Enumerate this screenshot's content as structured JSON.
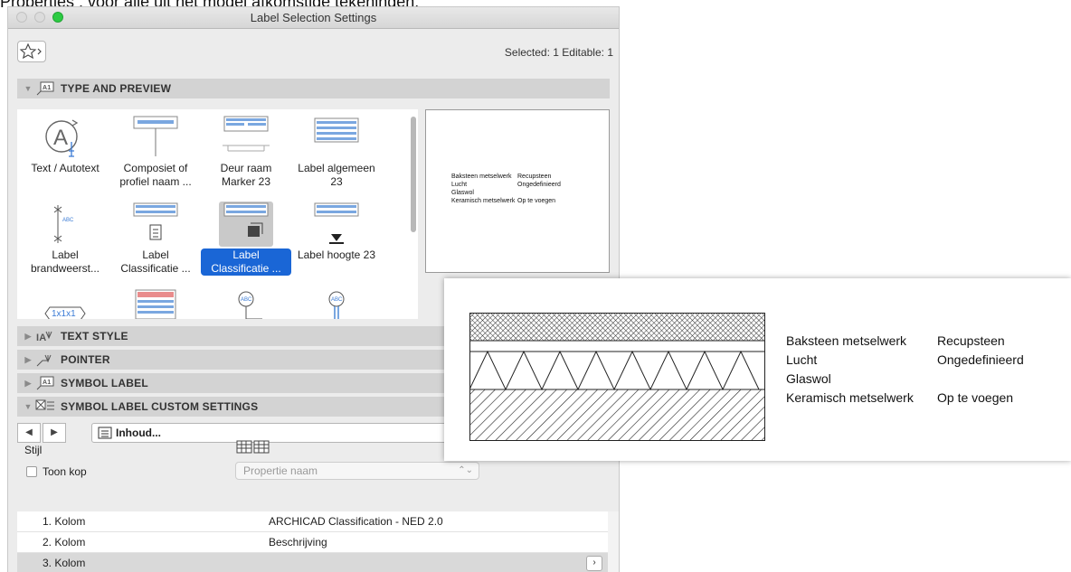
{
  "caption": "Properties , voor alle uit het model afkomstige tekeningen.",
  "window": {
    "title": "Label Selection Settings"
  },
  "header": {
    "selected_info": "Selected: 1 Editable: 1"
  },
  "sections": {
    "type_preview": "TYPE AND PREVIEW",
    "text_style": "TEXT STYLE",
    "pointer": "POINTER",
    "symbol_label": "SYMBOL LABEL",
    "custom_settings": "SYMBOL LABEL CUSTOM SETTINGS"
  },
  "gallery": [
    {
      "label": "Text / Autotext",
      "icon": "autotext-icon"
    },
    {
      "label": "Composiet of profiel naam ...",
      "icon": "composite-label-icon"
    },
    {
      "label": "Deur raam Marker 23",
      "icon": "door-window-marker-icon"
    },
    {
      "label": "Label algemeen 23",
      "icon": "general-label-icon"
    },
    {
      "label": "Label brandweerst...",
      "icon": "fire-resistance-label-icon"
    },
    {
      "label": "Label Classificatie ...",
      "icon": "classification-label-icon"
    },
    {
      "label": "Label Classificatie ...",
      "icon": "classification-label-3d-icon",
      "selected": true
    },
    {
      "label": "Label hoogte 23",
      "icon": "height-label-icon"
    },
    {
      "label": "",
      "icon": "dimension-label-icon",
      "text": "1x1x1"
    },
    {
      "label": "",
      "icon": "table-label-icon"
    },
    {
      "label": "",
      "icon": "circle-label-icon",
      "text": "ABC"
    },
    {
      "label": "",
      "icon": "circle-label-2-icon",
      "text": "ABC"
    }
  ],
  "preview": {
    "rows": [
      [
        "Baksteen metselwerk",
        "Recupsteen"
      ],
      [
        "Lucht",
        "Ongedefinieerd"
      ],
      [
        "Glaswol",
        ""
      ],
      [
        "Keramisch metselwerk",
        "Op te voegen"
      ]
    ]
  },
  "custom": {
    "content_button": "Inhoud...",
    "style_label": "Stijl",
    "toon_kop": "Toon kop",
    "property_placeholder": "Propertie naam",
    "columns": [
      {
        "name": "1. Kolom",
        "value": "ARCHICAD Classification - NED 2.0"
      },
      {
        "name": "2. Kolom",
        "value": "Beschrijving"
      },
      {
        "name": "3. Kolom",
        "value": ""
      }
    ]
  },
  "zoom": {
    "rows": [
      [
        "Baksteen metselwerk",
        "Recupsteen"
      ],
      [
        "Lucht",
        "Ongedefinieerd"
      ],
      [
        "Glaswol",
        ""
      ],
      [
        "Keramisch metselwerk",
        "Op te voegen"
      ]
    ]
  }
}
